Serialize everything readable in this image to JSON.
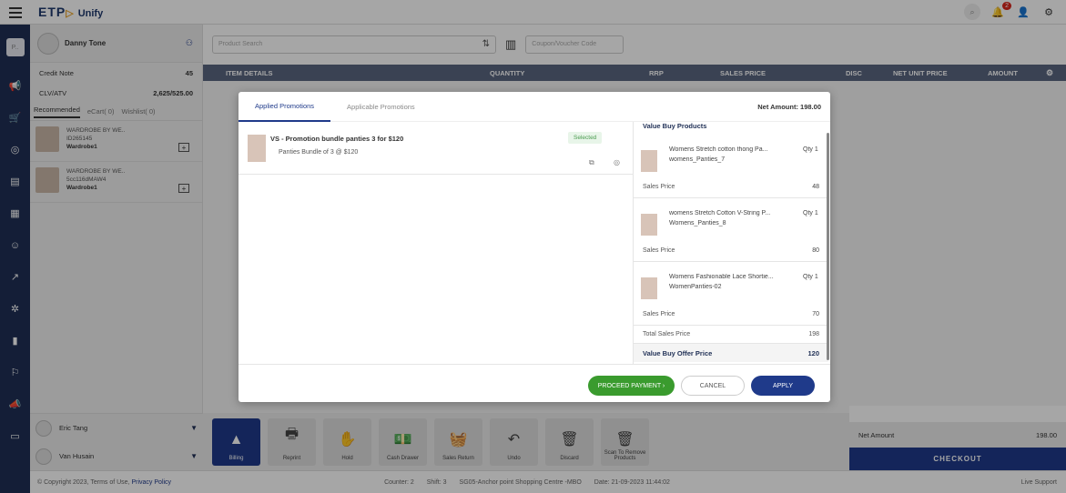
{
  "app": {
    "logo": "ETP",
    "logo_suffix": "Unify",
    "notif_count": "2"
  },
  "customer": {
    "name": "Danny Tone",
    "credit_note_label": "Credit Note",
    "credit_note_value": "45",
    "clv_label": "CLV/ATV",
    "clv_value": "2,625/525.00"
  },
  "left_tabs": [
    "Recommended",
    "eCart( 0)",
    "Wishlist( 0)"
  ],
  "recommended": [
    {
      "brand": "WARDROBE BY WE..",
      "id": "ID265145",
      "name": "Wardrobe1"
    },
    {
      "brand": "WARDROBE BY WE..",
      "id": "5cc116dMAW4",
      "name": "Wardrobe1"
    }
  ],
  "sales_reps": [
    {
      "name": "Eric Tang"
    },
    {
      "name": "Van Husain"
    }
  ],
  "search": {
    "placeholder": "Product Search",
    "coupon_placeholder": "Coupon/Voucher Code"
  },
  "table_headers": {
    "item": "ITEM DETAILS",
    "qty": "QUANTITY",
    "rrp": "RRP",
    "sales": "SALES PRICE",
    "disc": "DISC",
    "net": "NET UNIT PRICE",
    "amount": "AMOUNT"
  },
  "function_buttons": [
    "Billing",
    "Reprint",
    "Hold",
    "Cash Drawer",
    "Sales Return",
    "Undo",
    "Discard",
    "Scan To Remove Products"
  ],
  "net_amount": {
    "label": "Net Amount",
    "value": "198.00",
    "checkout": "CHECKOUT"
  },
  "footer": {
    "copyright": "© Copyright 2023, Terms of Use,",
    "privacy": "Privacy Policy",
    "counter": "Counter: 2",
    "shift": "Shift: 3",
    "store": "SG05-Anchor point Shopping Centre -MBO",
    "date": "Date: 21-09-2023 11:44:02",
    "live": "Live Support"
  },
  "modal": {
    "tabs": [
      "Applied Promotions",
      "Applicable Promotions"
    ],
    "net_amount": "Net Amount: 198.00",
    "promo_title": "VS - Promotion bundle panties 3 for $120",
    "promo_sub": "Panties Bundle of 3 @ $120",
    "selected": "Selected",
    "value_buy_header": "Value Buy Products",
    "products": [
      {
        "name": "Womens Stretch cotton thong Pa...",
        "code": "womens_Panties_7",
        "qty": "Qty 1",
        "price_label": "Sales Price",
        "price": "48"
      },
      {
        "name": "womens Stretch Cotton V-String P...",
        "code": "Womens_Panties_8",
        "qty": "Qty 1",
        "price_label": "Sales Price",
        "price": "80"
      },
      {
        "name": "Womens Fashionable Lace Shortie...",
        "code": "WomenPanties-02",
        "qty": "Qty 1",
        "price_label": "Sales Price",
        "price": "70"
      }
    ],
    "total_label": "Total Sales Price",
    "total_value": "198",
    "offer_label": "Value Buy Offer Price",
    "offer_value": "120",
    "btn_proceed": "PROCEED PAYMENT ›",
    "btn_cancel": "CANCEL",
    "btn_apply": "APPLY"
  }
}
